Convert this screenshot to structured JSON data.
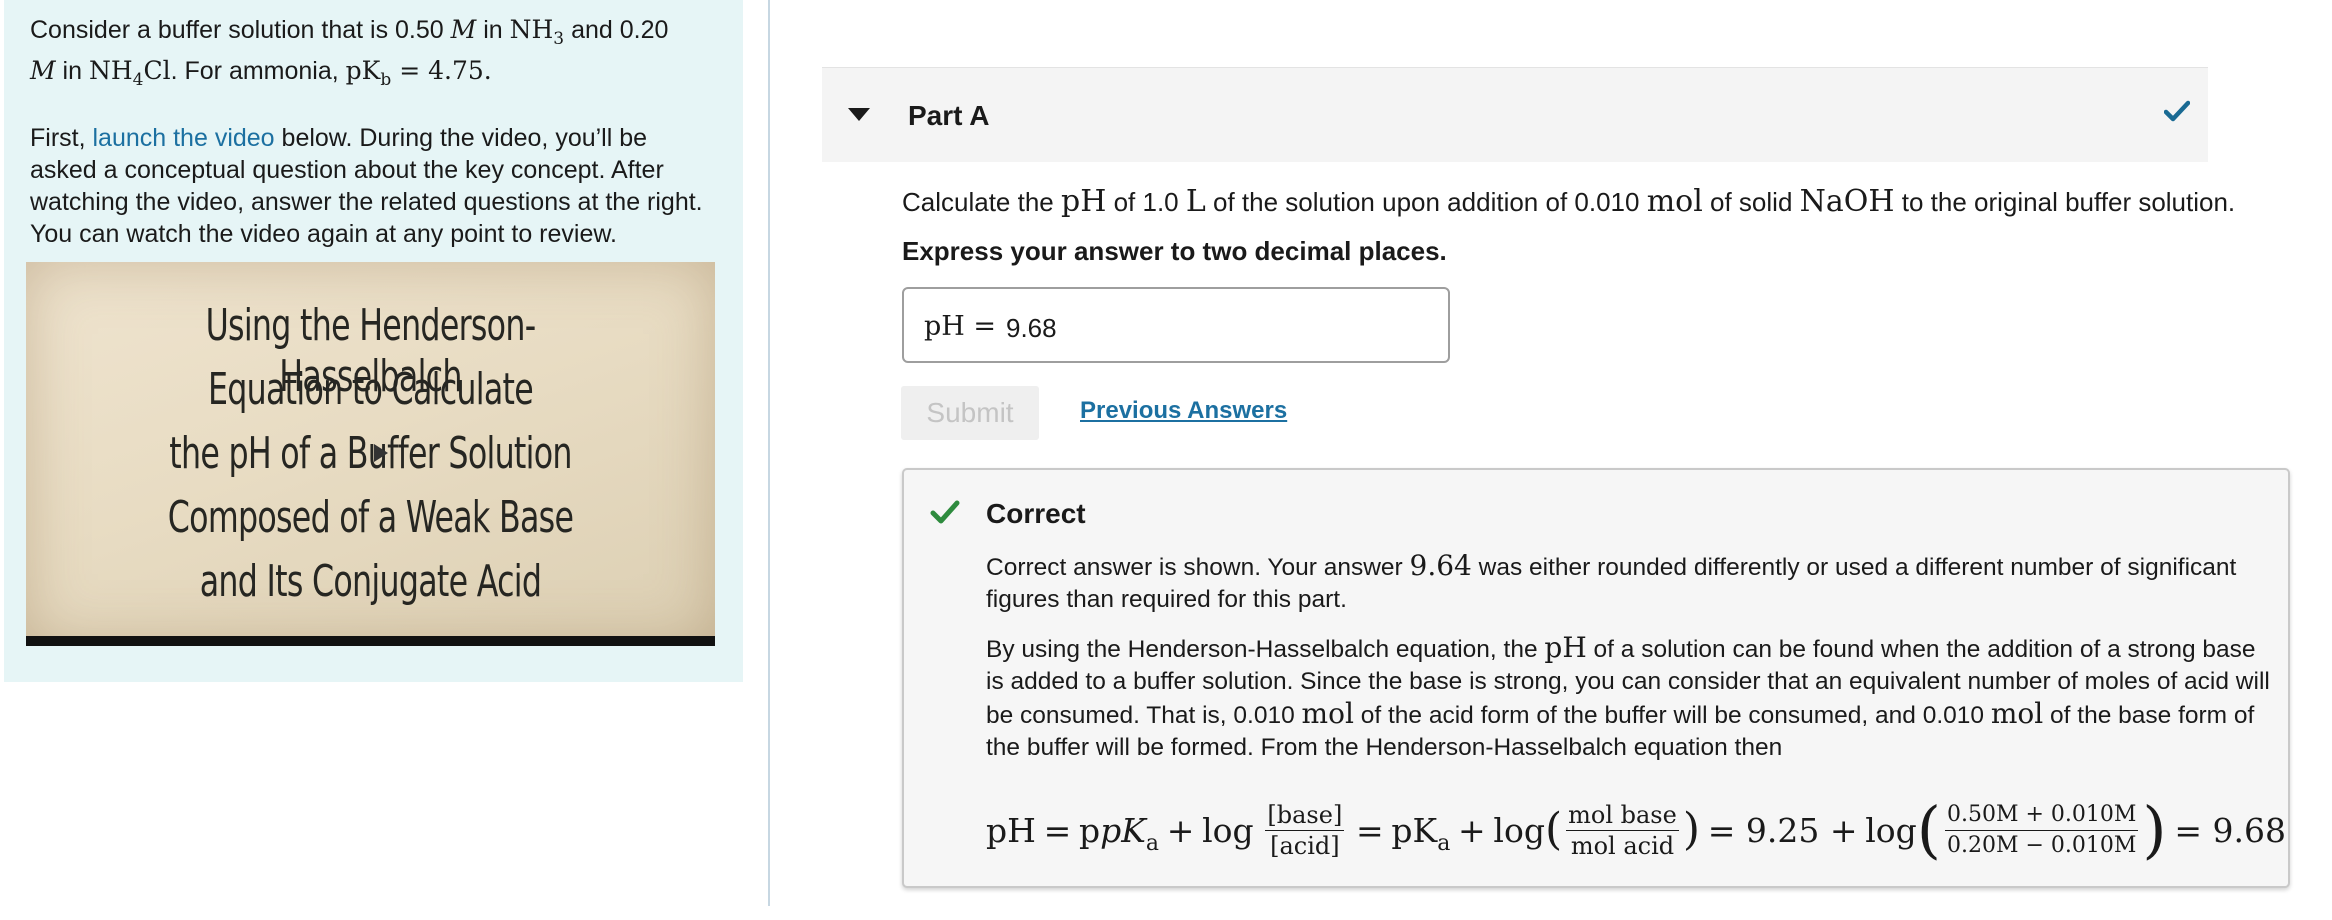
{
  "left_panel": {
    "intro_t1": "Consider a buffer solution that is 0.50 ",
    "intro_M1": "M",
    "intro_t2": " in ",
    "intro_nh3": "NH",
    "intro_nh3_sub": "3",
    "intro_t3": " and 0.20",
    "intro_M2": "M",
    "intro_t4": " in ",
    "intro_nh4": "NH",
    "intro_nh4_sub": "4",
    "intro_cl": "Cl",
    "intro_t5": ". For ammonia, ",
    "intro_pk": "pK",
    "intro_pk_sub": "b",
    "intro_pk_val": " = 4.75.",
    "p2_a": "First, ",
    "p2_link": "launch the video",
    "p2_b": " below. During the video, you’ll be asked a conceptual question about the key concept. After watching the video, answer the related questions at the right. You can watch the video again at any point to review.",
    "video_lines": [
      "Using the Henderson-Hasselbalch",
      "Equation to Calculate",
      "the pH of a Buffer Solution",
      "Composed of a Weak Base",
      "and Its Conjugate Acid"
    ]
  },
  "part": {
    "title": "Part A",
    "status": "correct",
    "question_a": "Calculate the ",
    "question_ph": "pH",
    "question_b": " of 1.0 ",
    "question_L": "L",
    "question_c": " of the solution upon addition of 0.010 ",
    "question_mol": "mol",
    "question_d": " of solid ",
    "question_naoh": "NaOH",
    "question_e": " to the original buffer solution.",
    "instruction": "Express your answer to two decimal places.",
    "answer_label": "pH =",
    "answer_value": "9.68",
    "submit_label": "Submit",
    "previous_answers_label": "Previous Answers"
  },
  "feedback": {
    "title": "Correct",
    "p1_a": "Correct answer is shown. Your answer ",
    "p1_value": "9.64",
    "p1_b": " was either rounded differently or used a different number of significant figures than required for this part.",
    "p2_a": "By using the Henderson-Hasselbalch equation, the ",
    "p2_ph": "pH",
    "p2_b": " of a solution can be found when the addition of a strong base is added to a buffer solution. Since the base is strong, you can consider that an equivalent number of moles of acid will be consumed. That is, 0.010 ",
    "p2_mol1": "mol",
    "p2_c": " of the acid form of the buffer will be consumed, and 0.010 ",
    "p2_mol2": "mol",
    "p2_d": " of the base form of the buffer will be formed. From the Henderson-Hasselbalch equation then",
    "eq": {
      "ph": "pH",
      "eq1": "=",
      "pk1": "pK",
      "pk1_sub": "a",
      "plus1": "+",
      "log1": "log",
      "num1": "[base]",
      "den1": "[acid]",
      "eq2": "=",
      "pk2": "pK",
      "pk2_sub": "a",
      "plus2": "+",
      "log2": "log",
      "num2": "mol base",
      "den2": "mol acid",
      "eq3": "= 9.25 +",
      "log3": "log",
      "num3": "0.50M + 0.010M",
      "den3": "0.20M − 0.010M",
      "result": "= 9.68"
    }
  },
  "colors": {
    "accent_link": "#1c70a1",
    "check_green": "#2e8b3e",
    "header_check": "#1a6a93",
    "left_panel_bg": "#e6f5f6"
  }
}
